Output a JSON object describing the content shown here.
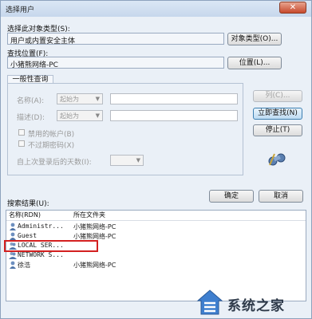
{
  "window": {
    "title": "选择用户",
    "close_glyph": "✕"
  },
  "object_type": {
    "label": "选择此对象类型(S):",
    "value": "用户或内置安全主体",
    "button": "对象类型(O)..."
  },
  "location": {
    "label": "查找位置(F):",
    "value": "小猪熊网络-PC",
    "button": "位置(L)..."
  },
  "query": {
    "tab": "一般性查询",
    "name_label": "名称(A):",
    "name_op": "起始为",
    "desc_label": "描述(D):",
    "desc_op": "起始为",
    "disabled_accounts": "禁用的帐户(B)",
    "no_expire_pw": "不过期密码(X)",
    "days_label": "自上次登录后的天数(I):",
    "columns_btn": "列(C)...",
    "find_now_btn": "立即查找(N)",
    "stop_btn": "停止(T)"
  },
  "results": {
    "label": "搜索结果(U):",
    "ok": "确定",
    "cancel": "取消",
    "columns": [
      "名称(RDN)",
      "所在文件夹"
    ],
    "rows": [
      {
        "name": "Administr...",
        "folder": "小猪熊网络-PC"
      },
      {
        "name": "Guest",
        "folder": "小猪熊网络-PC"
      },
      {
        "name": "LOCAL SER...",
        "folder": ""
      },
      {
        "name": "NETWORK S...",
        "folder": ""
      },
      {
        "name": "徐浩",
        "folder": "小猪熊网络-PC"
      }
    ]
  },
  "watermark": {
    "text": "系统之家"
  },
  "colors": {
    "accent": "#3c7fb1",
    "highlight_box": "#d32020",
    "titlebar": "#c6d7ec"
  }
}
